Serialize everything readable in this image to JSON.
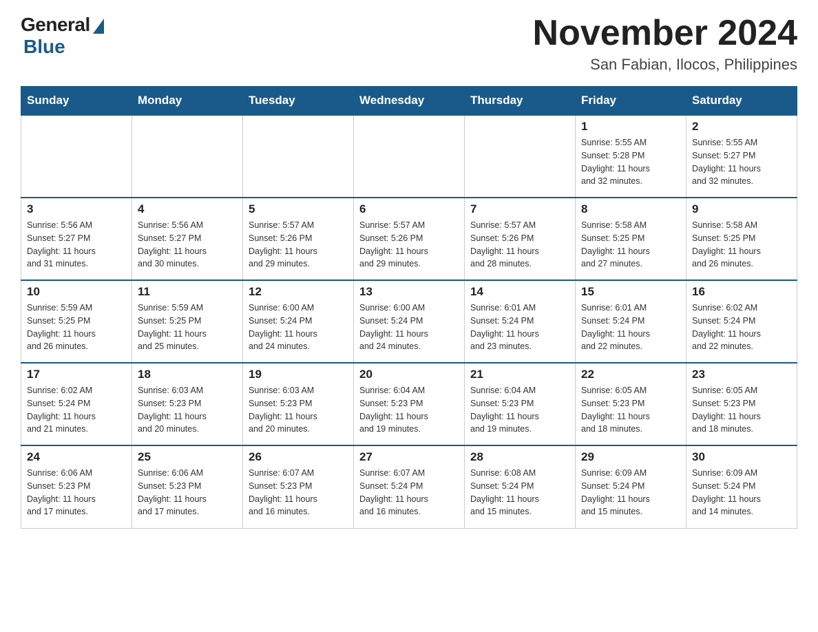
{
  "logo": {
    "general": "General",
    "blue": "Blue"
  },
  "header": {
    "month": "November 2024",
    "location": "San Fabian, Ilocos, Philippines"
  },
  "weekdays": [
    "Sunday",
    "Monday",
    "Tuesday",
    "Wednesday",
    "Thursday",
    "Friday",
    "Saturday"
  ],
  "weeks": [
    [
      {
        "day": "",
        "info": ""
      },
      {
        "day": "",
        "info": ""
      },
      {
        "day": "",
        "info": ""
      },
      {
        "day": "",
        "info": ""
      },
      {
        "day": "",
        "info": ""
      },
      {
        "day": "1",
        "info": "Sunrise: 5:55 AM\nSunset: 5:28 PM\nDaylight: 11 hours\nand 32 minutes."
      },
      {
        "day": "2",
        "info": "Sunrise: 5:55 AM\nSunset: 5:27 PM\nDaylight: 11 hours\nand 32 minutes."
      }
    ],
    [
      {
        "day": "3",
        "info": "Sunrise: 5:56 AM\nSunset: 5:27 PM\nDaylight: 11 hours\nand 31 minutes."
      },
      {
        "day": "4",
        "info": "Sunrise: 5:56 AM\nSunset: 5:27 PM\nDaylight: 11 hours\nand 30 minutes."
      },
      {
        "day": "5",
        "info": "Sunrise: 5:57 AM\nSunset: 5:26 PM\nDaylight: 11 hours\nand 29 minutes."
      },
      {
        "day": "6",
        "info": "Sunrise: 5:57 AM\nSunset: 5:26 PM\nDaylight: 11 hours\nand 29 minutes."
      },
      {
        "day": "7",
        "info": "Sunrise: 5:57 AM\nSunset: 5:26 PM\nDaylight: 11 hours\nand 28 minutes."
      },
      {
        "day": "8",
        "info": "Sunrise: 5:58 AM\nSunset: 5:25 PM\nDaylight: 11 hours\nand 27 minutes."
      },
      {
        "day": "9",
        "info": "Sunrise: 5:58 AM\nSunset: 5:25 PM\nDaylight: 11 hours\nand 26 minutes."
      }
    ],
    [
      {
        "day": "10",
        "info": "Sunrise: 5:59 AM\nSunset: 5:25 PM\nDaylight: 11 hours\nand 26 minutes."
      },
      {
        "day": "11",
        "info": "Sunrise: 5:59 AM\nSunset: 5:25 PM\nDaylight: 11 hours\nand 25 minutes."
      },
      {
        "day": "12",
        "info": "Sunrise: 6:00 AM\nSunset: 5:24 PM\nDaylight: 11 hours\nand 24 minutes."
      },
      {
        "day": "13",
        "info": "Sunrise: 6:00 AM\nSunset: 5:24 PM\nDaylight: 11 hours\nand 24 minutes."
      },
      {
        "day": "14",
        "info": "Sunrise: 6:01 AM\nSunset: 5:24 PM\nDaylight: 11 hours\nand 23 minutes."
      },
      {
        "day": "15",
        "info": "Sunrise: 6:01 AM\nSunset: 5:24 PM\nDaylight: 11 hours\nand 22 minutes."
      },
      {
        "day": "16",
        "info": "Sunrise: 6:02 AM\nSunset: 5:24 PM\nDaylight: 11 hours\nand 22 minutes."
      }
    ],
    [
      {
        "day": "17",
        "info": "Sunrise: 6:02 AM\nSunset: 5:24 PM\nDaylight: 11 hours\nand 21 minutes."
      },
      {
        "day": "18",
        "info": "Sunrise: 6:03 AM\nSunset: 5:23 PM\nDaylight: 11 hours\nand 20 minutes."
      },
      {
        "day": "19",
        "info": "Sunrise: 6:03 AM\nSunset: 5:23 PM\nDaylight: 11 hours\nand 20 minutes."
      },
      {
        "day": "20",
        "info": "Sunrise: 6:04 AM\nSunset: 5:23 PM\nDaylight: 11 hours\nand 19 minutes."
      },
      {
        "day": "21",
        "info": "Sunrise: 6:04 AM\nSunset: 5:23 PM\nDaylight: 11 hours\nand 19 minutes."
      },
      {
        "day": "22",
        "info": "Sunrise: 6:05 AM\nSunset: 5:23 PM\nDaylight: 11 hours\nand 18 minutes."
      },
      {
        "day": "23",
        "info": "Sunrise: 6:05 AM\nSunset: 5:23 PM\nDaylight: 11 hours\nand 18 minutes."
      }
    ],
    [
      {
        "day": "24",
        "info": "Sunrise: 6:06 AM\nSunset: 5:23 PM\nDaylight: 11 hours\nand 17 minutes."
      },
      {
        "day": "25",
        "info": "Sunrise: 6:06 AM\nSunset: 5:23 PM\nDaylight: 11 hours\nand 17 minutes."
      },
      {
        "day": "26",
        "info": "Sunrise: 6:07 AM\nSunset: 5:23 PM\nDaylight: 11 hours\nand 16 minutes."
      },
      {
        "day": "27",
        "info": "Sunrise: 6:07 AM\nSunset: 5:24 PM\nDaylight: 11 hours\nand 16 minutes."
      },
      {
        "day": "28",
        "info": "Sunrise: 6:08 AM\nSunset: 5:24 PM\nDaylight: 11 hours\nand 15 minutes."
      },
      {
        "day": "29",
        "info": "Sunrise: 6:09 AM\nSunset: 5:24 PM\nDaylight: 11 hours\nand 15 minutes."
      },
      {
        "day": "30",
        "info": "Sunrise: 6:09 AM\nSunset: 5:24 PM\nDaylight: 11 hours\nand 14 minutes."
      }
    ]
  ]
}
